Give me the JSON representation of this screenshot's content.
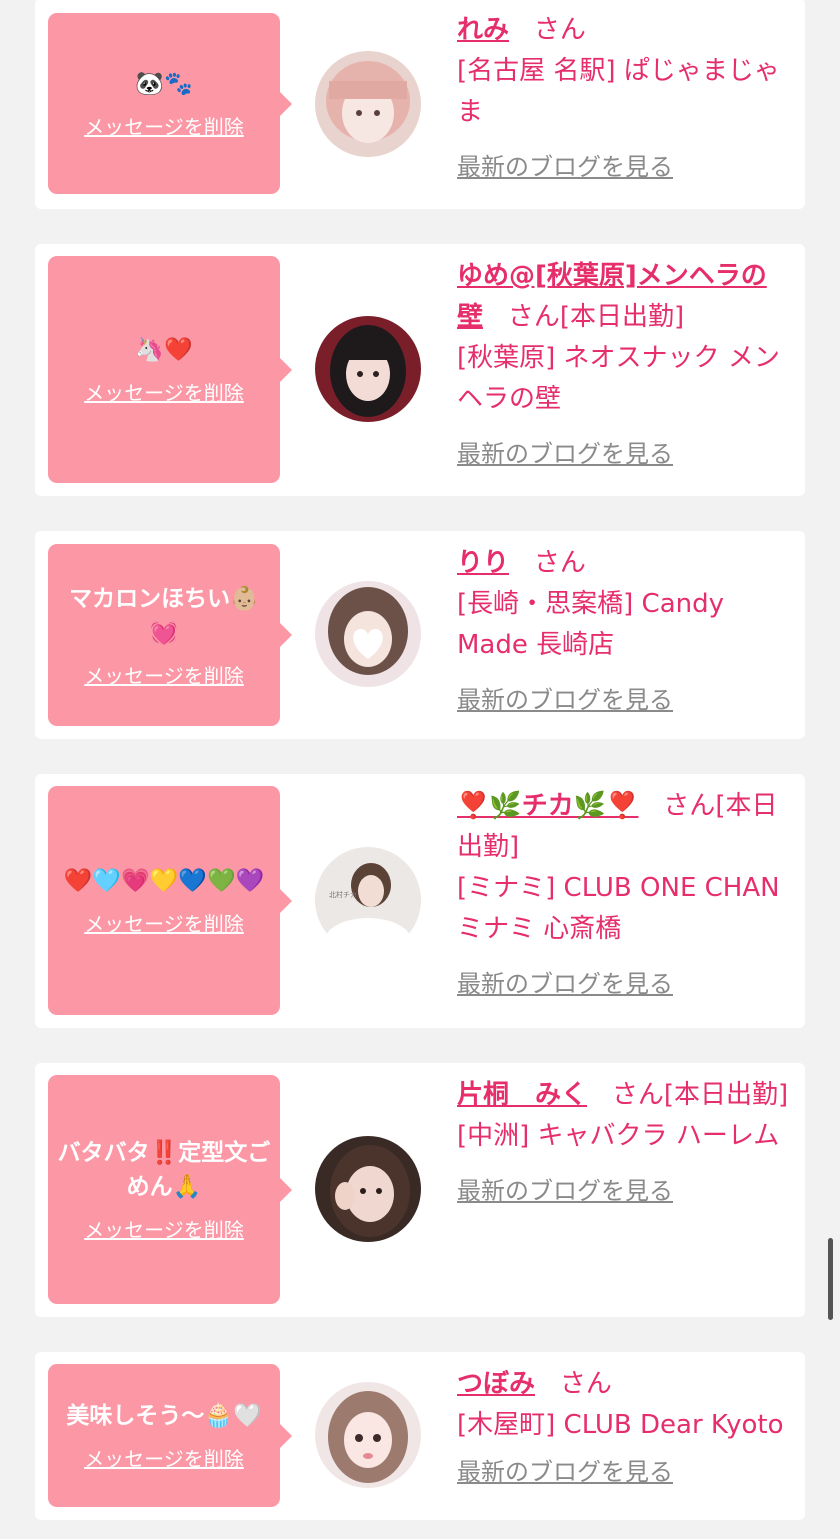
{
  "delete_label": "メッセージを削除",
  "blog_label": "最新のブログを見る",
  "san": "さん",
  "colors": {
    "bubble": "#fc97a6",
    "accent": "#e62e6b",
    "link_gray": "#8a8a8a",
    "card": "#ffffff",
    "page": "#f2f2f2"
  },
  "items": [
    {
      "message": "🐼🐾",
      "name": "れみ",
      "status": "",
      "shop": "[名古屋 名駅] ぱじゃまじゃま",
      "avatar_icon": "girl-avatar-pink-hair"
    },
    {
      "message": "🦄❤️",
      "name": "ゆめ@[秋葉原]メンヘラの壁",
      "status": "[本日出勤]",
      "shop": "[秋葉原] ネオスナック メンヘラの壁",
      "avatar_icon": "girl-avatar-dark-hair"
    },
    {
      "message": "マカロンほちい👶🏼💓",
      "name": "りり",
      "status": "",
      "shop": "[長崎・思案橋] Candy Made 長崎店",
      "avatar_icon": "girl-avatar-heart-face"
    },
    {
      "message": "❤️🩵💗💛💙💚💜",
      "name": "❣️🌿チカ🌿❣️",
      "status": "[本日出勤]",
      "shop": "[ミナミ] CLUB ONE CHAN ミナミ 心斎橋",
      "avatar_icon": "girl-avatar-white-dress"
    },
    {
      "message": "バタバタ‼️定型文ごめん🙏",
      "name": "片桐　みく",
      "status": "[本日出勤]",
      "shop": "[中洲] キャバクラ ハーレム",
      "avatar_icon": "girl-avatar-peace-sign"
    },
    {
      "message": "美味しそう〜🧁🤍",
      "name": "つぼみ",
      "status": "",
      "shop": "[木屋町] CLUB Dear Kyoto",
      "avatar_icon": "girl-avatar-light-hair"
    }
  ]
}
